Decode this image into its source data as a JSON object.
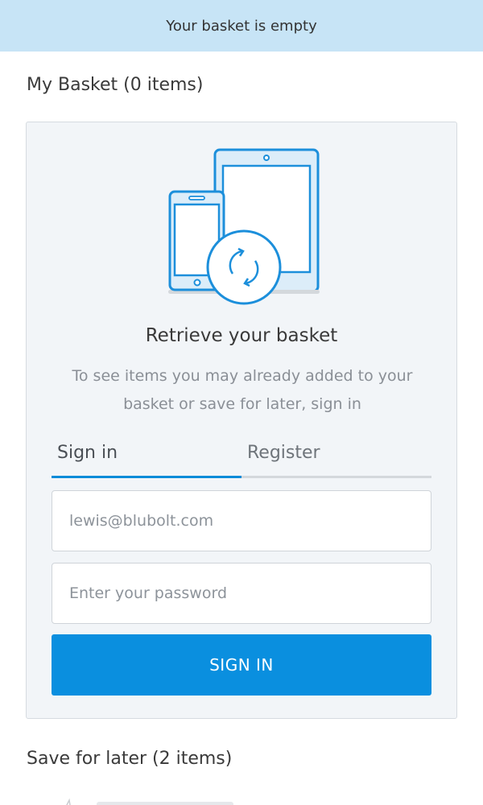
{
  "banner": {
    "text": "Your basket is empty"
  },
  "basket": {
    "title": "My Basket (0 items)"
  },
  "retrieve": {
    "title": "Retrieve your basket",
    "description": "To see items you may already added to your basket or save for later, sign in"
  },
  "tabs": [
    {
      "label": "Sign in",
      "active": true
    },
    {
      "label": "Register",
      "active": false
    }
  ],
  "form": {
    "email_placeholder": "lewis@blubolt.com",
    "password_placeholder": "Enter your password",
    "submit_label": "SIGN IN"
  },
  "save_for_later": {
    "title": "Save for later (2 items)"
  },
  "colors": {
    "banner_bg": "#c7e4f6",
    "accent": "#0a8fdf",
    "panel_bg": "#f2f5f8",
    "illustration_stroke": "#1c8fdb",
    "illustration_fill": "#dcedf9"
  },
  "icons": [
    "devices-sync-icon"
  ]
}
